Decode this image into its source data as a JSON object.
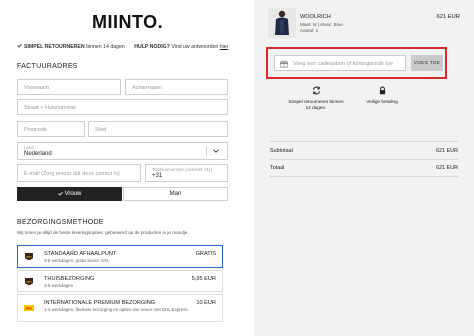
{
  "brand": {
    "logo_text": "MIINTO."
  },
  "top_notes": {
    "returns_bold": "SIMPEL RETOURNEREN",
    "returns_text": "binnen 14 dagen",
    "help_bold": "HULP NODIG?",
    "help_text": "Vind uw antwoorden",
    "help_link": "hier"
  },
  "billing": {
    "title": "FACTUURADRES",
    "first_name_placeholder": "Voornaam",
    "last_name_placeholder": "Achternaam",
    "street_placeholder": "Straat + Huisnummer",
    "postcode_placeholder": "Postcode",
    "city_placeholder": "Stad",
    "country_label": "Land",
    "country_value": "Nederland",
    "email_placeholder": "E-mail (Zorg ervoor dat deze correct is)",
    "phone_label": "Telefoonnummer (inclusief +31)",
    "phone_prefix": "+31",
    "gender_female": "Vrouw",
    "gender_male": "Man"
  },
  "shipping": {
    "title": "BEZORGINGSMETHODE",
    "note": "Wij tonen je altijd de beste leveringsopties, gebaseerd op de producten in je mandje.",
    "options": [
      {
        "name": "STANDAARD AFHAALPUNT",
        "desc": "3-5 werkdagen, gratis boven 100,-",
        "price": "GRATIS",
        "carrier": "UPS",
        "selected": true
      },
      {
        "name": "THUISBEZORGING",
        "desc": "3-5 werkdagen",
        "price": "5,95 EUR",
        "carrier": "UPS",
        "selected": false
      },
      {
        "name": "INTERNATIONALE PREMIUM BEZORGING",
        "desc": "1-4 werkdagen, flexibele bezorging en opties van retour met DHL Express.",
        "price": "10 EUR",
        "carrier": "DHL",
        "selected": false
      }
    ]
  },
  "cart": {
    "product_name": "WOOLRICH",
    "product_size": "Maat: M",
    "product_color": "Kleur: Blue",
    "product_qty": "Aantal: 1",
    "product_price": "621 EUR"
  },
  "coupon": {
    "placeholder": "Voeg een cadeaubon of kortingscode toe",
    "button": "VOEG TOE"
  },
  "benefits": {
    "returns": "Simpel retourneren binnen 14 dagen.",
    "payment": "Veilige betaling"
  },
  "summary": {
    "subtotal_label": "Subtotaal",
    "subtotal_value": "621 EUR",
    "total_label": "Totaal",
    "total_value": "621 EUR"
  },
  "colors": {
    "accent_blue": "#2a66c7",
    "highlight_red": "#d32c2c",
    "ups_brown": "#3b2416",
    "ups_gold": "#f5b400",
    "dhl_yellow": "#ffcc00",
    "dhl_red": "#d40511"
  }
}
